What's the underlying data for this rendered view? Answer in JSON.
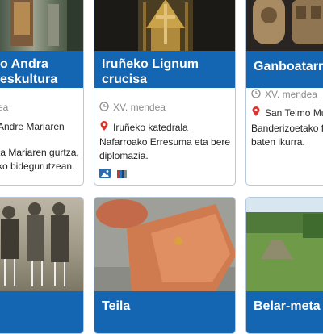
{
  "cards": [
    {
      "title_lines": [
        "o Andra",
        "eskultura"
      ],
      "period": "ea",
      "location": "Andre Mariaren",
      "description_lines": [
        "ta Mariaren gurtza,",
        "ko bidegurutzean."
      ]
    },
    {
      "title_lines": [
        "Iruñeko Lignum",
        "crucisa"
      ],
      "period": "XV. mendea",
      "location": "Iruñeko katedrala",
      "description_lines": [
        "Nafarroako Erresuma eta bere",
        "diplomazia."
      ],
      "icons": [
        "image-icon",
        "flag-stripes-icon"
      ]
    },
    {
      "title_lines": [
        "Ganboatarre"
      ],
      "period": "XV. mendea",
      "location": "San Telmo Mus",
      "description_lines": [
        "Banderizoetako fa",
        "baten ikurra."
      ]
    },
    {
      "title_lines": [
        ""
      ]
    },
    {
      "title_lines": [
        "Teila"
      ]
    },
    {
      "title_lines": [
        "Belar-meta"
      ]
    }
  ],
  "icon_names": {
    "period": "clock-icon",
    "location": "map-pin-icon"
  },
  "colors": {
    "title_band": "#1566b2",
    "card_border": "#b7c8dc",
    "period_text": "#8a8a8a",
    "pin": "#d9342b"
  }
}
